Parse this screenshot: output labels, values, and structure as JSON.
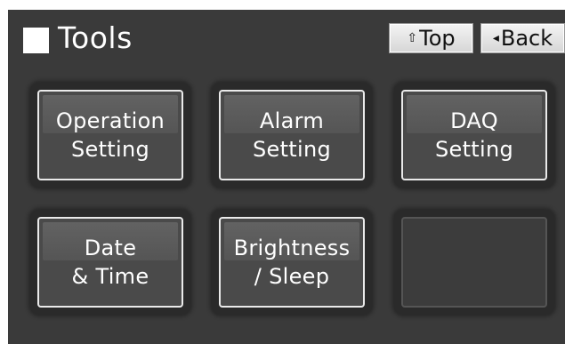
{
  "header": {
    "title": "Tools",
    "top_button": {
      "arrow": "⇧",
      "label": "Top"
    },
    "back_button": {
      "arrow": "◂",
      "label": "Back"
    }
  },
  "tiles": [
    {
      "label": "Operation\nSetting"
    },
    {
      "label": "Alarm\nSetting"
    },
    {
      "label": "DAQ\nSetting"
    },
    {
      "label": "Date\n& Time"
    },
    {
      "label": "Brightness\n/ Sleep"
    },
    {
      "label": ""
    }
  ],
  "colors": {
    "screen_background": "#3a3a3a",
    "tile_border": "#eaeaea",
    "text": "#ffffff"
  }
}
